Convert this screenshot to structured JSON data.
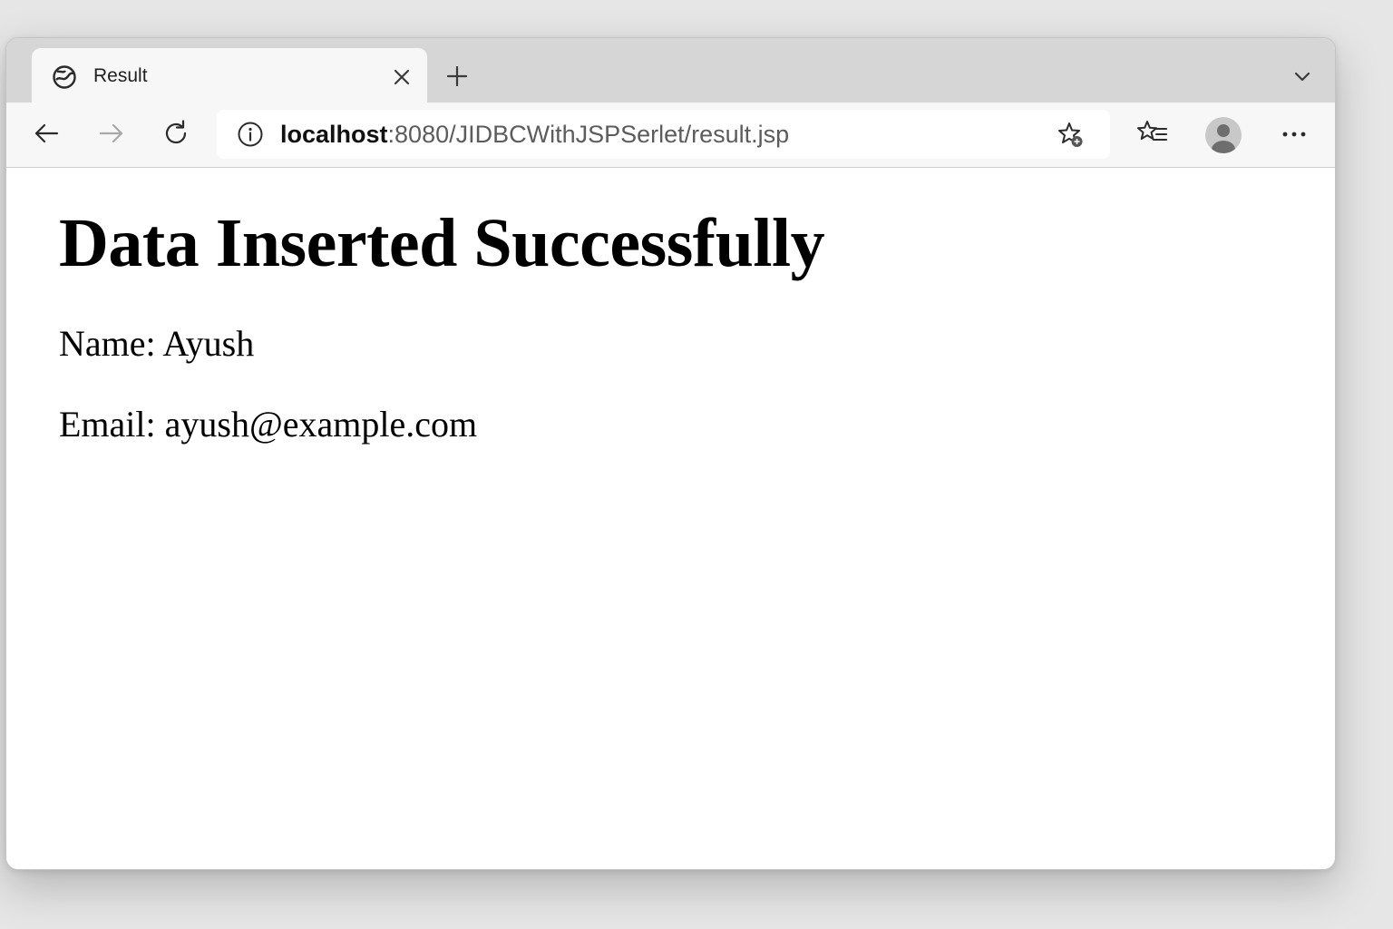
{
  "tab": {
    "title": "Result"
  },
  "address_bar": {
    "host": "localhost",
    "path": ":8080/JIDBCWithJSPSerlet/result.jsp"
  },
  "page": {
    "heading": "Data Inserted Successfully",
    "name_line": "Name: Ayush",
    "email_line": "Email: ayush@example.com"
  },
  "icons": {
    "favicon": "globe-icon",
    "tab_close": "close-icon",
    "new_tab": "plus-icon",
    "tab_list": "chevron-down-icon",
    "back": "arrow-left-icon",
    "forward": "arrow-right-icon",
    "refresh": "refresh-icon",
    "site_info": "info-icon",
    "add_favorite": "star-plus-icon",
    "favorites": "favorites-list-icon",
    "profile": "avatar-icon",
    "menu": "more-icon"
  },
  "colors": {
    "tabstrip_bg": "#d6d6d6",
    "toolbar_bg": "#f7f7f7",
    "page_bg": "#ffffff",
    "text": "#000000"
  }
}
